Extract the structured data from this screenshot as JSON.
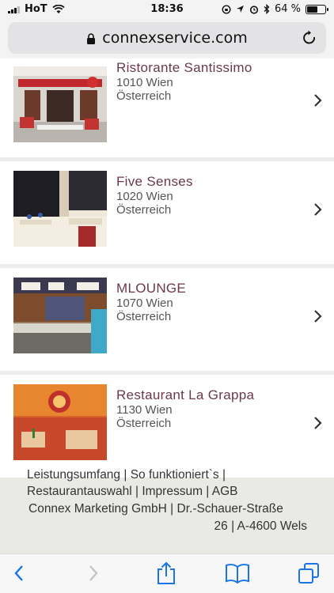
{
  "status_bar": {
    "carrier": "HoT",
    "time": "18:36",
    "battery_percent": "64 %",
    "battery_level": 0.64,
    "icons": [
      "signal-icon",
      "wifi-icon",
      "rotation-lock-icon",
      "location-icon",
      "alarm-icon",
      "bluetooth-icon",
      "battery-icon"
    ]
  },
  "browser": {
    "url": "connexservice.com",
    "icons": [
      "lock-icon",
      "reload-icon"
    ]
  },
  "restaurants": [
    {
      "name": "Ristorante Santissimo",
      "city": "1010 Wien",
      "country": "Österreich"
    },
    {
      "name": "Five Senses",
      "city": "1020 Wien",
      "country": "Österreich"
    },
    {
      "name": "MLOUNGE",
      "city": "1070 Wien",
      "country": "Österreich"
    },
    {
      "name": "Restaurant La Grappa",
      "city": "1130 Wien",
      "country": "Österreich"
    }
  ],
  "footer": {
    "line1": "Leistungsumfang | So funktioniert`s |",
    "line2": "Restaurantauswahl | Impressum | AGB",
    "line3": "Connex Marketing GmbH | Dr.-Schauer-Straße",
    "line4": "26 | A-4600 Wels"
  },
  "toolbar": {
    "icons": [
      "back-icon",
      "forward-icon",
      "share-icon",
      "bookmarks-icon",
      "tabs-icon"
    ]
  },
  "colors": {
    "accent": "#1a73e8",
    "restaurant_name": "#6a3a48",
    "footer_bg": "#e9e9e5"
  }
}
